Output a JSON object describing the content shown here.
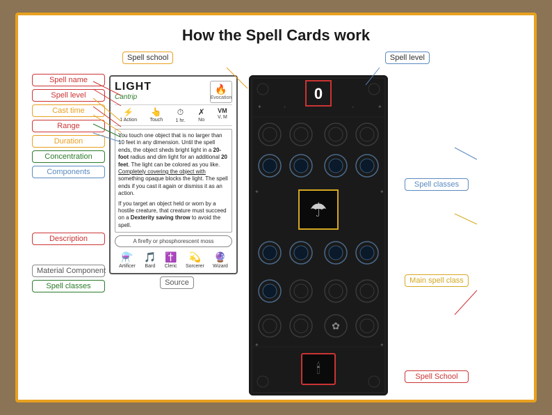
{
  "page": {
    "title": "How the Spell Cards work",
    "background_color": "#8b7355",
    "border_color": "#e8a020"
  },
  "top_labels": {
    "spell_school": "Spell school",
    "spell_level": "Spell level"
  },
  "left_labels": {
    "spell_name": "Spell name",
    "spell_level": "Spell level",
    "cast_time": "Cast time",
    "range": "Range",
    "duration": "Duration",
    "concentration": "Concentration",
    "components": "Components",
    "description": "Description",
    "material_component": "Material Component",
    "spell_classes": "Spell classes"
  },
  "right_labels": {
    "spell_classes": "Spell classes",
    "main_spell_class": "Main spell class",
    "spell_school": "Spell School"
  },
  "spell_card": {
    "name": "LIGHT",
    "type": "Cantrip",
    "school": "Evocation",
    "stats": [
      {
        "icon": "⚡",
        "value": "1 Action",
        "label": ""
      },
      {
        "icon": "👆",
        "value": "Touch",
        "label": ""
      },
      {
        "icon": "⏱",
        "value": "1 hr.",
        "label": ""
      },
      {
        "icon": "✗",
        "value": "No",
        "label": ""
      },
      {
        "icon": "VM",
        "value": "V, M",
        "label": ""
      }
    ],
    "description_p1": "You touch one object that is no larger than 10 feet in any dimension. Until the spell ends, the object sheds bright light in a 20-foot radius and dim light for an additional 20 feet. The light can be colored as you like. Completely covering the object with something opaque blocks the light. The spell ends if you cast it again or dismiss it as an action.",
    "description_p2": "If you target an object held or worn by a hostile creature, that creature must succeed on a Dexterity saving throw to avoid the spell.",
    "material": "A firefly or phosphorescent moss",
    "classes": [
      "Artificer",
      "Bard",
      "Cleric",
      "Sorcerer",
      "Wizard"
    ],
    "source": "Source"
  },
  "dark_card": {
    "level": "0",
    "level_border_color": "#cc3333",
    "main_icon_color": "#d4a820"
  }
}
